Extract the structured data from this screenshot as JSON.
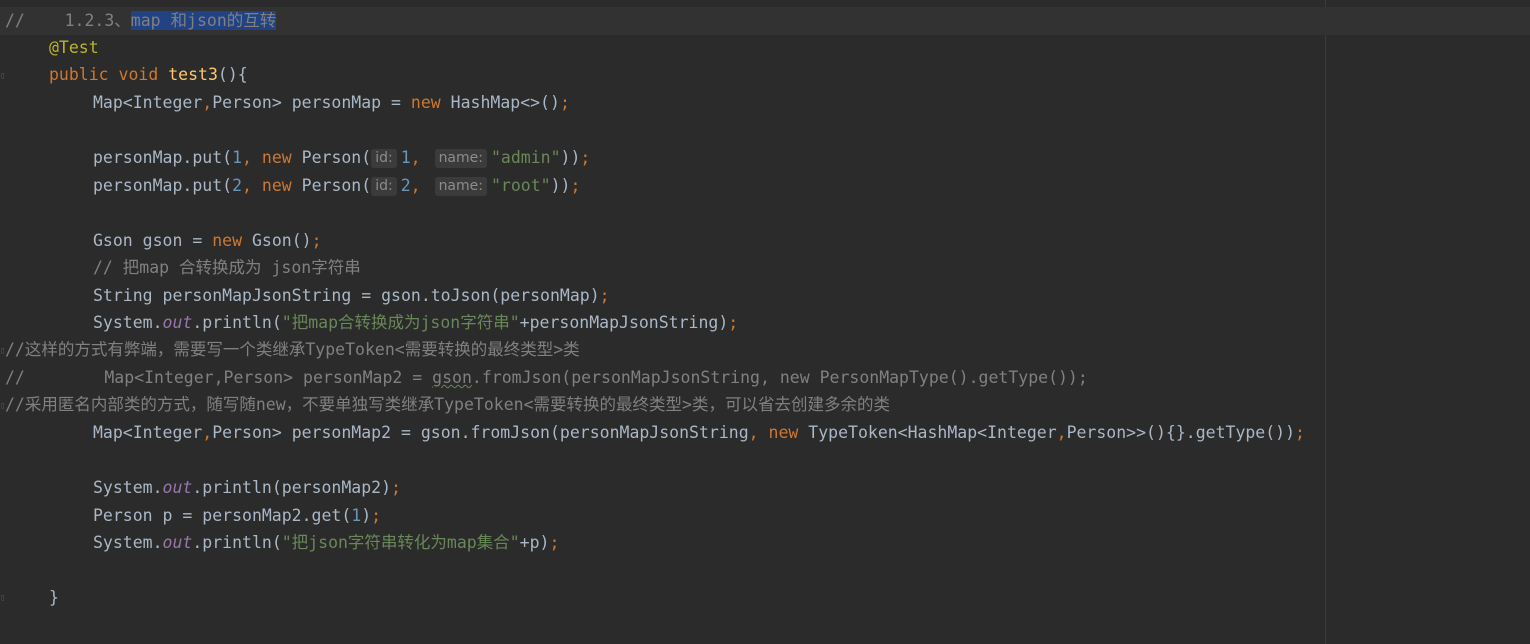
{
  "editor": {
    "heading_comment_prefix": "//    1.2.3、",
    "heading_comment_selected": "map 和json的互转",
    "annotation": "@Test",
    "method": {
      "modifiers": "public void ",
      "name": "test3",
      "rest": "(){"
    },
    "map_decl_type": "Map<Integer",
    "comma": ",",
    "map_decl_mid": "Person> personMap = ",
    "kw_new": "new",
    "map_decl_end": " HashMap<>()",
    "semicolon": ";",
    "put_call": "personMap.put(",
    "put1_num": "1",
    "put2_num": "2",
    "comma_space": ", ",
    "person_ctor": " Person(",
    "hint_id": "id:",
    "hint_name": "name:",
    "str_admin": "\"admin\"",
    "str_root": "\"root\"",
    "close_paren2": "))",
    "gson_decl": "Gson gson = ",
    "gson_ctor": " Gson()",
    "comment_to_json": "// 把map 合转换成为 json字符串",
    "string_decl": "String personMapJsonString = gson.toJson(personMap)",
    "system": "System.",
    "out": "out",
    "println_open": ".println(",
    "str_print1": "\"把map合转换成为json字符串\"",
    "print1_rest": "+personMapJsonString)",
    "comment_drawback": "//这样的方式有弊端，需要写一个类继承TypeToken<需要转换的最终类型>类",
    "comment_old_line_prefix": "//        Map<Integer,Person> personMap2 = ",
    "comment_old_gson": "gson",
    "comment_old_line_rest": ".fromJson(personMapJsonString, new PersonMapType().getType());",
    "comment_anon": "//采用匿名内部类的方式，随写随new，不要单独写类继承TypeToken<需要转换的最终类型>类，可以省去创建多余的类",
    "map2_decl_mid": "Person> personMap2 = gson.fromJson(personMapJsonString",
    "typetoken_a": " TypeToken<HashMap<Integer",
    "typetoken_b": "Person>>(){}.getType())",
    "print2_rest": "personMap2)",
    "person_p": "Person p = personMap2.get(",
    "get_num": "1",
    "close_paren": ")",
    "str_print3": "\"把json字符串转化为map集合\"",
    "print3_rest": "+p)",
    "closing_brace": "}"
  },
  "colors": {
    "background": "#2b2b2b",
    "keyword": "#cc7832",
    "method_name": "#ffc66d",
    "annotation": "#bbb529",
    "number": "#6897bb",
    "string": "#6a8759",
    "comment": "#808080",
    "static_field": "#9876aa",
    "selection": "#214283"
  }
}
